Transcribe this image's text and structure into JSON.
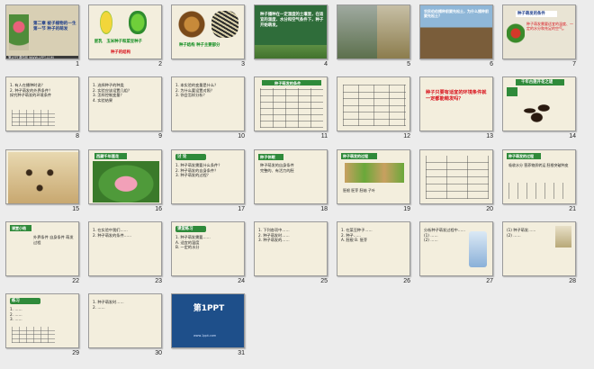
{
  "slides": [
    {
      "n": "1",
      "title": "第二章 被子植物的一生\n第一节 种子的萌发",
      "foot": "第1PPT课件网 WWW.1PPT.COM"
    },
    {
      "n": "2",
      "caption": "胚乳   玉米种子和菜豆种子",
      "caption2": "种子的结构"
    },
    {
      "n": "3",
      "caption": "种子结构 种子主要部分"
    },
    {
      "n": "4",
      "caption": "种子播种在一定湿度的土壤里，在适宜的温度、水分和空气条件下，种子开始萌发。"
    },
    {
      "n": "5",
      "caption": ""
    },
    {
      "n": "6",
      "caption": "农民伯伯播种前要先松土，为什么播种前要先松土？"
    },
    {
      "n": "7",
      "header": "种子萌发的条件",
      "caption": "种子萌发需要适宜的温度、一定的水分和充足的空气。"
    },
    {
      "n": "8",
      "caption": "1. 有人在播种时说？\n2. 种子萌发的外界条件？\n探究种子萌发的环境条件"
    },
    {
      "n": "9",
      "caption": "1. 选择种子的种类\n2. 实验应该设置几组？\n3. 怎样控制变量？\n4. 实验结果"
    },
    {
      "n": "10",
      "caption": "1. 本实验的变量是什么？\n2. 为什么要设置对照？\n3. 你会怎样分析？"
    },
    {
      "n": "11",
      "header": "种子萌发的条件",
      "caption": ""
    },
    {
      "n": "12",
      "caption": ""
    },
    {
      "n": "13",
      "caption": "种子只要有适宜的环境条件就一定都能萌发吗？"
    },
    {
      "n": "14",
      "header": "千年古莲开花之谜",
      "caption": ""
    },
    {
      "n": "15",
      "caption": ""
    },
    {
      "n": "16",
      "header": "西藏千年莲花",
      "caption": ""
    },
    {
      "n": "17",
      "header": "讨 论",
      "caption": "1. 种子萌发需要什么条件？\n2. 种子萌发的自身条件？\n3. 种子萌发的过程？"
    },
    {
      "n": "18",
      "header": "种子休眠",
      "caption": "种子萌发的自身条件\n完整的、有活力的胚"
    },
    {
      "n": "19",
      "header": "种子萌发的过程",
      "caption": "胚根 胚芽 胚轴 子叶"
    },
    {
      "n": "20",
      "caption": ""
    },
    {
      "n": "21",
      "header": "种子萌发的过程",
      "caption": "吸收水分 营养物质转运 胚根突破种皮"
    },
    {
      "n": "22",
      "header": "课堂小结",
      "caption": "外界条件 自身条件 萌发过程"
    },
    {
      "n": "23",
      "caption": "1. 在实验中我们……\n2. 种子萌发的条件……"
    },
    {
      "n": "24",
      "header": "课堂练习",
      "caption": "1. 种子萌发需要……\nA. 适宜的温度\nB. 一定的水分"
    },
    {
      "n": "25",
      "caption": "1. 下列各项中……\n2. 种子萌发时……\n3. 种子萌发的……"
    },
    {
      "n": "26",
      "caption": "1. 在菜豆种子……\n2. 种子……\nA. 胚根 B. 胚芽"
    },
    {
      "n": "27",
      "caption": "分析种子萌发过程中……\n(1) ……\n(2) ……"
    },
    {
      "n": "28",
      "caption": "(1) 种子萌发……\n(2) ……"
    },
    {
      "n": "29",
      "header": "练习",
      "caption": "1. ……\n2. ……\n3. ……"
    },
    {
      "n": "30",
      "caption": "1. 种子萌发时……\n2. ……"
    },
    {
      "n": "31",
      "logo": "第1PPT",
      "url": "www.1ppt.com"
    }
  ],
  "colors": {
    "slide_bg": "#f3eedd",
    "green_bg": "#2f6d3a",
    "red": "#d8101a",
    "blue_bg": "#1e4f8a"
  }
}
